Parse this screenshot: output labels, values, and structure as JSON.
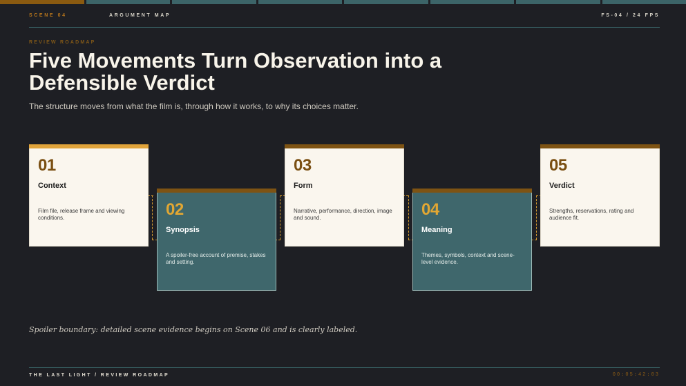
{
  "header": {
    "scene": "SCENE 04",
    "section": "ARGUMENT MAP",
    "frame_rate": "FS-04 / 24 FPS",
    "progress": {
      "total_segments": 8,
      "current_segment": 1
    }
  },
  "kicker": "REVIEW ROADMAP",
  "title": "Five Movements Turn Observation into a Defensible Verdict",
  "subtitle": "The structure moves from what the film is, through how it works, to why its choices matter.",
  "steps": [
    {
      "number": "01",
      "name": "Context",
      "description": "Film file, release frame and viewing conditions."
    },
    {
      "number": "02",
      "name": "Synopsis",
      "description": "A spoiler-free account of premise, stakes and setting."
    },
    {
      "number": "03",
      "name": "Form",
      "description": "Narrative, performance, direction, image and sound."
    },
    {
      "number": "04",
      "name": "Meaning",
      "description": "Themes, symbols, context and scene-level evidence."
    },
    {
      "number": "05",
      "name": "Verdict",
      "description": "Strengths, reservations, rating and audience fit."
    }
  ],
  "note": "Spoiler boundary: detailed scene evidence begins on Scene 06 and is clearly labeled.",
  "footer": {
    "breadcrumb": "THE LAST LIGHT / REVIEW ROADMAP",
    "timecode": "00:05:42:03"
  },
  "colors": {
    "background": "#1e1f24",
    "accent_gold": "#e0a33a",
    "accent_brown": "#7e5313",
    "teal": "#3f676c",
    "card_light": "#faf6ee"
  }
}
